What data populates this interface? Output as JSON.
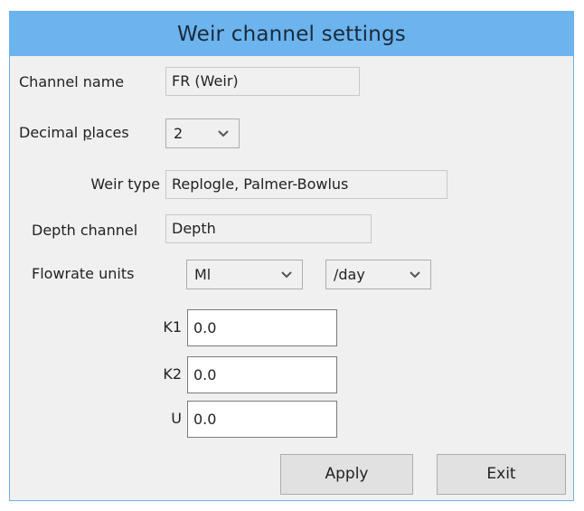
{
  "window": {
    "title": "Weir channel settings"
  },
  "form": {
    "channel_name": {
      "label": "Channel name",
      "value": "FR (Weir)"
    },
    "decimal_places": {
      "label_prefix": "Decimal ",
      "label_accel": "p",
      "label_suffix": "laces",
      "value": "2"
    },
    "weir_type": {
      "label": "Weir type",
      "value": "Replogle, Palmer-Bowlus"
    },
    "depth_channel": {
      "label": "Depth channel",
      "value": "Depth"
    },
    "flowrate_units": {
      "label": "Flowrate units",
      "volume_value": "Ml",
      "time_value": "/day"
    },
    "k1": {
      "label": "K1",
      "value": "0.0"
    },
    "k2": {
      "label": "K2",
      "value": "0.0"
    },
    "u": {
      "label": "U",
      "value": "0.0"
    }
  },
  "buttons": {
    "apply": "Apply",
    "exit": "Exit"
  },
  "icons": {
    "dropdown": "chevron-down-icon"
  },
  "colors": {
    "titlebar": "#6cb4ee",
    "background": "#f0f0f0",
    "button": "#e1e1e1"
  }
}
